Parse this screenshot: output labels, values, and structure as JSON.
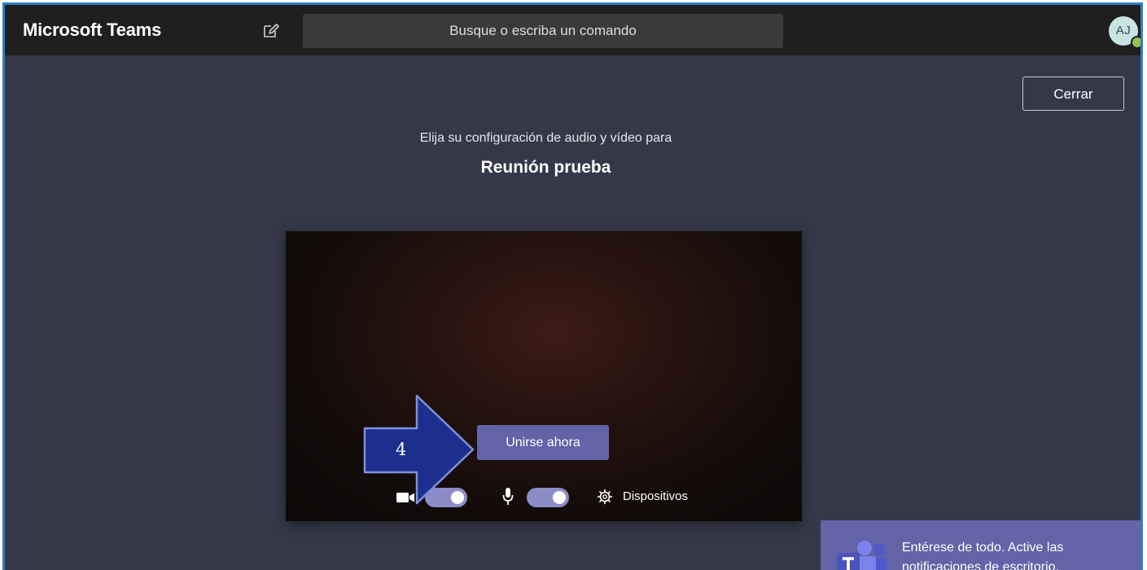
{
  "app": {
    "title": "Microsoft Teams"
  },
  "search": {
    "placeholder": "Busque o escriba un comando"
  },
  "user": {
    "initials": "AJ",
    "status": "available"
  },
  "header": {
    "close_label": "Cerrar"
  },
  "prejoin": {
    "subtitle": "Elija su configuración de audio y vídeo para",
    "meeting_name": "Reunión prueba",
    "join_label": "Unirse ahora",
    "camera_on": true,
    "mic_on": true,
    "devices_label": "Dispositivos"
  },
  "annotation": {
    "step_number": "4"
  },
  "toast": {
    "text": "Entérese de todo. Active las notificaciones de escritorio."
  },
  "colors": {
    "accent": "#6264a7",
    "toggle": "#8b8cc7",
    "background": "#36384a",
    "titlebar": "#1f1f1f",
    "annotation_arrow": "#1c2f8f",
    "presence": "#92c353"
  },
  "icons": [
    "compose-icon",
    "camera-icon",
    "microphone-icon",
    "gear-icon",
    "teams-logo-icon",
    "arrow-icon"
  ]
}
